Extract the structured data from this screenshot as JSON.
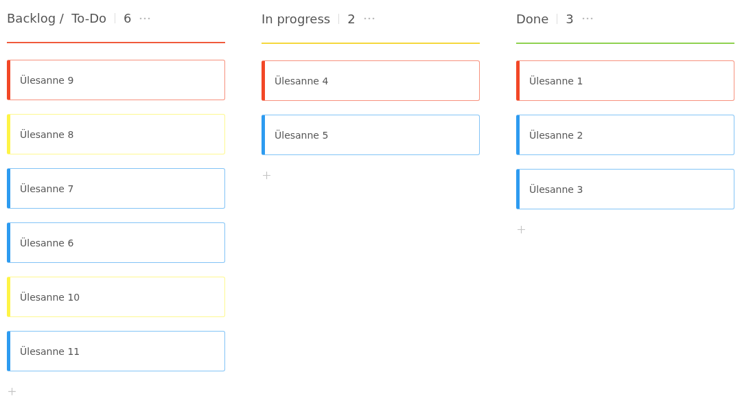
{
  "columns": [
    {
      "title": "Backlog /  To-Do",
      "count": "6",
      "color": "#f05a3c",
      "cards": [
        {
          "label": "Ülesanne 9",
          "color": "#f24726"
        },
        {
          "label": "Ülesanne 8",
          "color": "#fef445"
        },
        {
          "label": "Ülesanne 7",
          "color": "#2d9bf0"
        },
        {
          "label": "Ülesanne 6",
          "color": "#2d9bf0"
        },
        {
          "label": "Ülesanne 10",
          "color": "#fef445"
        },
        {
          "label": "Ülesanne 11",
          "color": "#2d9bf0"
        }
      ]
    },
    {
      "title": "In progress",
      "count": "2",
      "color": "#f5d73c",
      "cards": [
        {
          "label": "Ülesanne 4",
          "color": "#f24726"
        },
        {
          "label": "Ülesanne 5",
          "color": "#2d9bf0"
        }
      ]
    },
    {
      "title": "Done",
      "count": "3",
      "color": "#8fd14f",
      "cards": [
        {
          "label": "Ülesanne 1",
          "color": "#f24726"
        },
        {
          "label": "Ülesanne 2",
          "color": "#2d9bf0"
        },
        {
          "label": "Ülesanne 3",
          "color": "#2d9bf0"
        }
      ]
    }
  ]
}
